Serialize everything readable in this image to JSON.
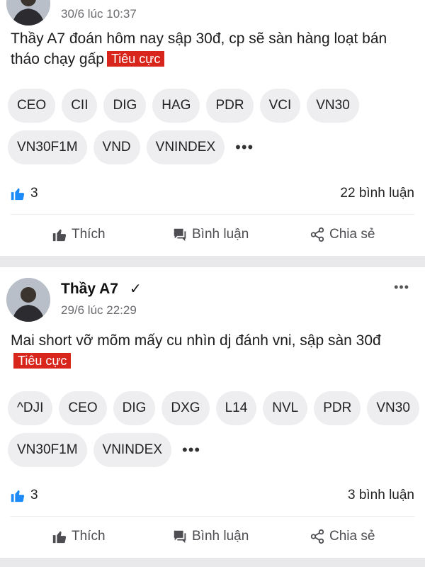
{
  "posts": [
    {
      "author": "",
      "verified_mark": "",
      "time": "30/6 lúc 10:37",
      "content": "Thầy A7 đoán hôm nay sập 30đ, cp sẽ sàn hàng loạt bán tháo chạy gấp",
      "sentiment": "Tiêu cực",
      "tag_rows": [
        [
          "CEO",
          "CII",
          "DIG",
          "HAG",
          "PDR",
          "VCI",
          "VN30"
        ],
        [
          "VN30F1M",
          "VND",
          "VNINDEX"
        ]
      ],
      "likes": "3",
      "comments": "22 bình luận"
    },
    {
      "author": "Thầy A7",
      "verified_mark": "✓",
      "time": "29/6 lúc 22:29",
      "content": "Mai short vỡ mõm mấy cu nhìn dj đánh vni, sập sàn 30đ",
      "sentiment": "Tiêu cực",
      "tag_rows": [
        [
          "^DJI",
          "CEO",
          "DIG",
          "DXG",
          "L14",
          "NVL",
          "PDR",
          "VN30"
        ],
        [
          "VN30F1M",
          "VNINDEX"
        ]
      ],
      "likes": "3",
      "comments": "3 bình luận"
    }
  ],
  "actions": {
    "like": "Thích",
    "comment": "Bình luận",
    "share": "Chia sẻ"
  },
  "more_tags_glyph": "•••",
  "more_menu_glyph": "•••",
  "colors": {
    "badge": "#d9261c",
    "like_icon": "#1d8cf8",
    "tag_bg": "#eeeef1",
    "separator": "#e9e9ec"
  }
}
